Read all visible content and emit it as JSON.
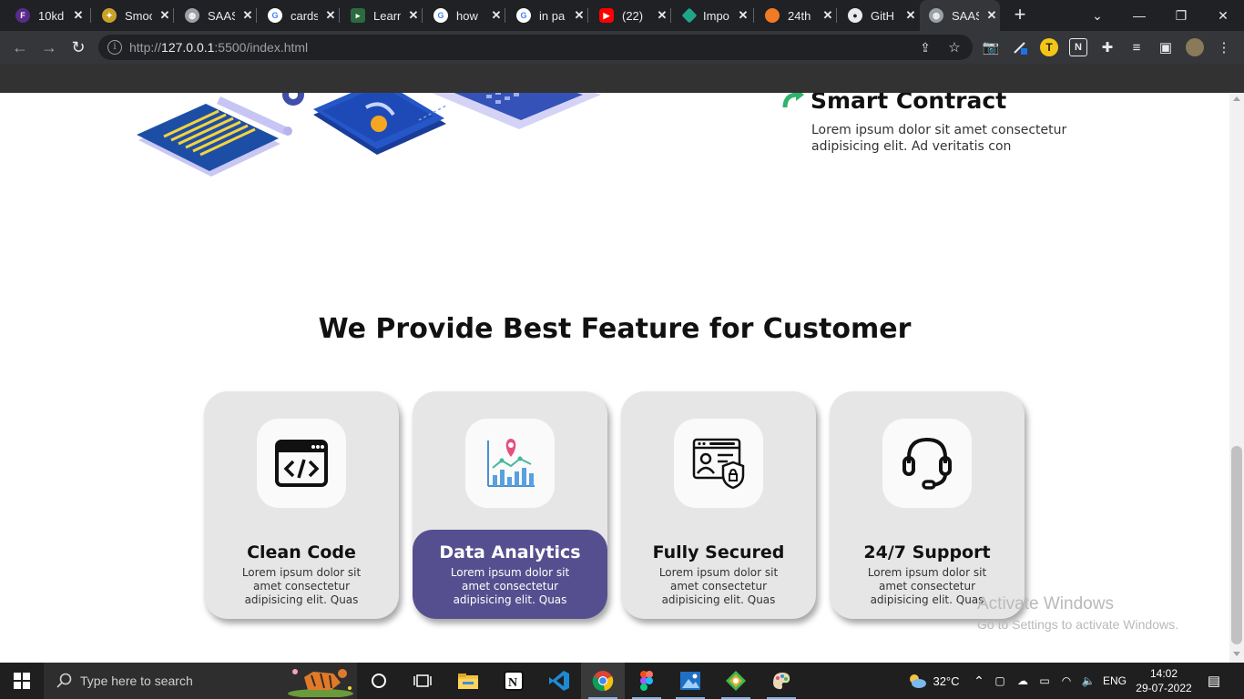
{
  "browser": {
    "tabs": [
      {
        "title": "10kd",
        "icon": "figma-community-icon",
        "color": "#5a2a8a"
      },
      {
        "title": "Smoo",
        "icon": "pineapple-icon",
        "color": "#c9a227"
      },
      {
        "title": "SAAS",
        "icon": "globe-icon",
        "color": "#9aa0a6"
      },
      {
        "title": "cards",
        "icon": "google-icon",
        "color": "#4285f4"
      },
      {
        "title": "Learn",
        "icon": "scrimba-icon",
        "color": "#2b6b3f"
      },
      {
        "title": "how",
        "icon": "google-icon",
        "color": "#4285f4"
      },
      {
        "title": "in pa",
        "icon": "google-icon",
        "color": "#4285f4"
      },
      {
        "title": "(22)",
        "icon": "youtube-icon",
        "color": "#ff0000"
      },
      {
        "title": "Impo",
        "icon": "diamond-icon",
        "color": "#1fa58a"
      },
      {
        "title": "24th",
        "icon": "circle-icon",
        "color": "#f07b24"
      },
      {
        "title": "GitH",
        "icon": "github-icon",
        "color": "#e8eaed"
      },
      {
        "title": "SAAS",
        "icon": "globe-icon",
        "color": "#9aa0a6"
      }
    ],
    "url_prefix": "http://",
    "url_host": "127.0.0.1",
    "url_rest": ":5500/index.html",
    "profile_initial": "T"
  },
  "page": {
    "contract_title": "Smart Contract",
    "contract_desc": "Lorem ipsum dolor sit amet consectetur adipisicing elit. Ad veritatis con",
    "section_title": "We Provide Best Feature for Customer",
    "cards": [
      {
        "title": "Clean Code",
        "desc": "Lorem ipsum dolor sit amet consectetur adipisicing elit. Quas",
        "icon": "code-window-icon"
      },
      {
        "title": "Data Analytics",
        "desc": "Lorem ipsum dolor sit amet consectetur adipisicing elit. Quas",
        "icon": "analytics-chart-icon"
      },
      {
        "title": "Fully Secured",
        "desc": "Lorem ipsum dolor sit amet consectetur adipisicing elit. Quas",
        "icon": "secure-profile-icon"
      },
      {
        "title": "24/7 Support",
        "desc": "Lorem ipsum dolor sit amet consectetur adipisicing elit. Quas",
        "icon": "headset-icon"
      }
    ],
    "active_card_color": "#564f8f",
    "accent_green": "#2fb36b"
  },
  "watermark": {
    "line1": "Activate Windows",
    "line2": "Go to Settings to activate Windows."
  },
  "taskbar": {
    "search_placeholder": "Type here to search",
    "weather": "32°C",
    "language": "ENG",
    "time": "14:02",
    "date": "29-07-2022"
  }
}
